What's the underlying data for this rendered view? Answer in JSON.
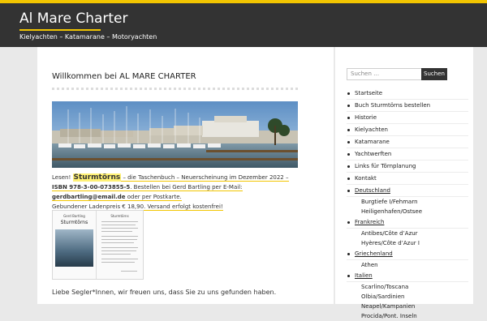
{
  "header": {
    "site_title": "Al Mare Charter",
    "tagline": "Kielyachten – Katamarane – Motoryachten",
    "accent_color": "#f2c500",
    "bar_color": "#333333"
  },
  "post": {
    "title": "Willkommen bei AL MARE CHARTER",
    "intro": {
      "lead": "Lesen! ",
      "book_name": "Sturmtörns",
      "mid": " – die Taschenbuch – Neuerscheinung im Dezember 2022 – ",
      "isbn": "ISBN 978-3-00-073855-5",
      "order_text": ". Bestellen bei Gerd Bartling per E-Mail: ",
      "email": "gerdbartling@email.de",
      "postal": " oder per Postkarte.",
      "price": "Gebundener Ladenpreis € 18,90. Versand erfolgt kostenfrei!"
    },
    "book": {
      "author": "Gerd Bartling",
      "title": "Sturmtörns",
      "right_title": "Sturmtörns"
    },
    "outro": "Liebe Segler*Innen, wir freuen uns, dass Sie zu uns gefunden haben."
  },
  "search": {
    "placeholder": "Suchen …",
    "button_label": "Suchen"
  },
  "menu": {
    "items": [
      {
        "label": "Startseite"
      },
      {
        "label": "Buch Sturmtörns bestellen"
      },
      {
        "label": "Historie"
      },
      {
        "label": "Kielyachten"
      },
      {
        "label": "Katamarane"
      },
      {
        "label": "Yachtwerften"
      },
      {
        "label": "Links für Törnplanung"
      },
      {
        "label": "Kontakt"
      }
    ],
    "groups": [
      {
        "label": "Deutschland",
        "subs": [
          "Burgtiefe I/Fehmarn",
          "Heiligenhafen/Ostsee"
        ]
      },
      {
        "label": "Frankreich",
        "subs": [
          "Antibes/Côte d’Azur",
          "Hyères/Côte d’Azur I"
        ]
      },
      {
        "label": "Griechenland",
        "subs": [
          "Athen"
        ]
      },
      {
        "label": "Italien",
        "subs": [
          "Scarlino/Toscana",
          "Olbia/Sardinien",
          "Neapel/Kampanien",
          "Procida/Pont. Inseln"
        ]
      }
    ]
  }
}
